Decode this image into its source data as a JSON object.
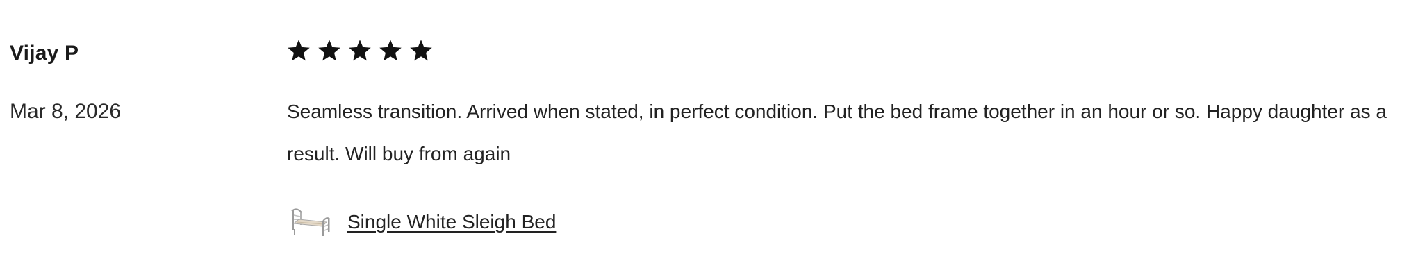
{
  "review": {
    "reviewer_name": "Vijay P",
    "date": "Mar 8, 2026",
    "rating": 5,
    "rating_max": 5,
    "text": "Seamless transition. Arrived when stated, in perfect condition. Put the bed frame together in an hour or so. Happy daughter as a result. Will buy from again",
    "product": {
      "name": "Single White Sleigh Bed",
      "thumbnail_icon": "bed-thumbnail"
    }
  },
  "colors": {
    "text": "#222222",
    "star": "#111111"
  }
}
